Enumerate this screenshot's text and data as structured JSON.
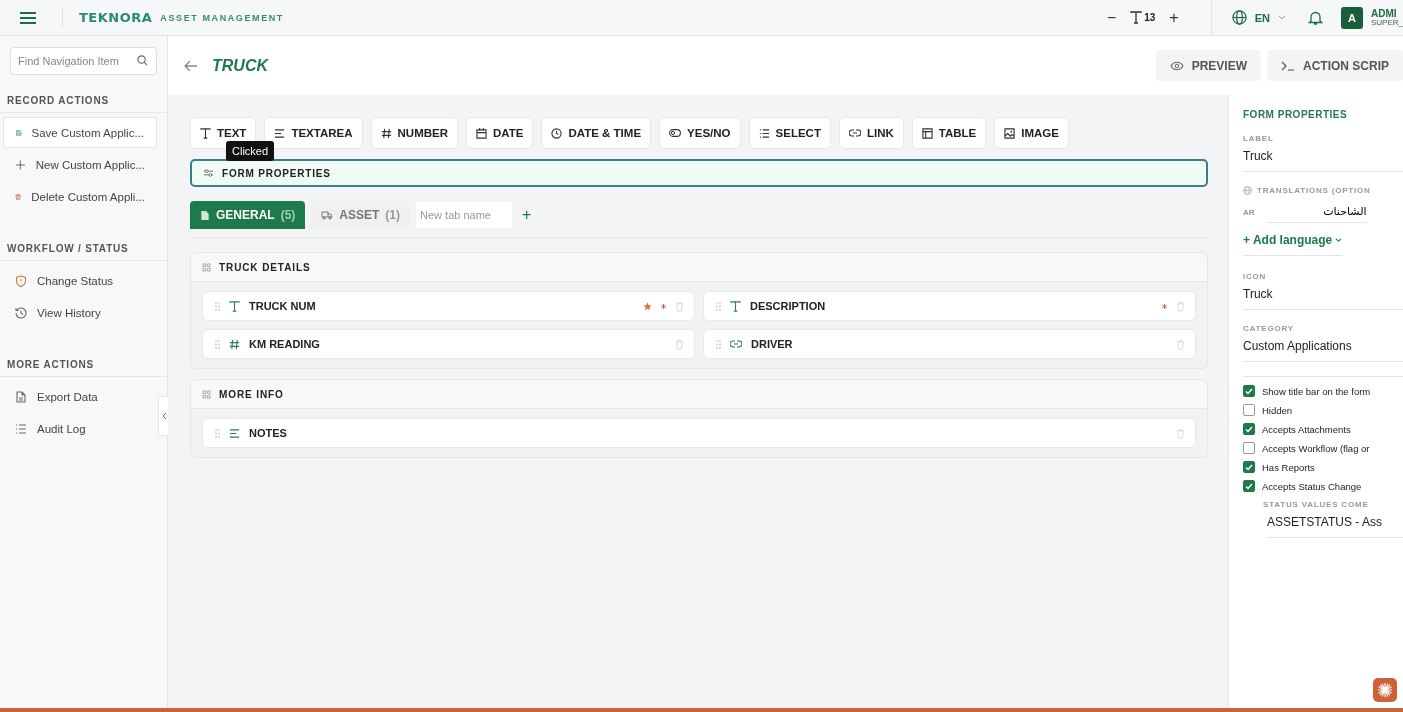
{
  "topbar": {
    "brand": "TEKNORA",
    "product": "ASSET MANAGEMENT",
    "font_decrease": "−",
    "font_size": "13",
    "font_increase": "+",
    "language": "EN",
    "avatar": "A",
    "user_name": "ADMI",
    "user_role": "SUPER_"
  },
  "sidebar": {
    "search": {
      "placeholder": "Find Navigation Item"
    },
    "sections": [
      {
        "title": "RECORD ACTIONS",
        "items": [
          {
            "label": "Save Custom Applic...",
            "selected": true
          },
          {
            "label": "New Custom Applic...",
            "selected": false
          },
          {
            "label": "Delete Custom Appli...",
            "selected": false
          }
        ]
      },
      {
        "title": "WORKFLOW / STATUS",
        "items": [
          {
            "label": "Change Status",
            "selected": false
          },
          {
            "label": "View History",
            "selected": false
          }
        ]
      },
      {
        "title": "MORE ACTIONS",
        "items": [
          {
            "label": "Export Data",
            "selected": false
          },
          {
            "label": "Audit Log",
            "selected": false
          }
        ]
      }
    ]
  },
  "header": {
    "title": "TRUCK",
    "buttons": [
      "PREVIEW",
      "ACTION SCRIP"
    ]
  },
  "field_types": [
    {
      "label": "TEXT",
      "kind": "text"
    },
    {
      "label": "TEXTAREA",
      "kind": "textarea"
    },
    {
      "label": "NUMBER",
      "kind": "number"
    },
    {
      "label": "DATE",
      "kind": "date"
    },
    {
      "label": "DATE & TIME",
      "kind": "datetime"
    },
    {
      "label": "YES/NO",
      "kind": "boolean"
    },
    {
      "label": "SELECT",
      "kind": "select"
    },
    {
      "label": "LINK",
      "kind": "link"
    },
    {
      "label": "TABLE",
      "kind": "table"
    },
    {
      "label": "IMAGE",
      "kind": "image"
    }
  ],
  "tooltip": "Clicked",
  "form_properties_bar": {
    "label": "FORM PROPERTIES",
    "selected": true
  },
  "tabs": [
    {
      "label": "GENERAL",
      "count": "(5)",
      "selected": true
    },
    {
      "label": "ASSET",
      "count": "(1)",
      "selected": false
    }
  ],
  "new_tab": {
    "placeholder": "New tab name",
    "add": "+"
  },
  "sections": [
    {
      "title": "TRUCK DETAILS",
      "fields": [
        {
          "label": "TRUCK NUM",
          "kind": "text",
          "starred": true,
          "required": true
        },
        {
          "label": "DESCRIPTION",
          "kind": "text",
          "starred": false,
          "required": true
        },
        {
          "label": "KM READING",
          "kind": "number",
          "starred": false,
          "required": false
        },
        {
          "label": "DRIVER",
          "kind": "link",
          "starred": false,
          "required": false
        }
      ]
    },
    {
      "title": "MORE INFO",
      "fields": [
        {
          "label": "NOTES",
          "kind": "textarea",
          "starred": false,
          "required": false
        }
      ]
    }
  ],
  "properties": {
    "title": "FORM PROPERTIES",
    "label_heading": "LABEL",
    "label_value": "Truck",
    "translations_heading": "TRANSLATIONS (OPTION",
    "translations": [
      {
        "lang": "AR",
        "value": "الشاحنات"
      }
    ],
    "add_language": "+ Add language",
    "icon_heading": "ICON",
    "icon_value": "Truck",
    "category_heading": "CATEGORY",
    "category_value": "Custom Applications",
    "options": [
      {
        "label": "Show title bar on the form",
        "checked": true
      },
      {
        "label": "Hidden",
        "checked": false
      },
      {
        "label": "Accepts Attachments",
        "checked": true
      },
      {
        "label": "Accepts Workflow (flag or",
        "checked": false
      },
      {
        "label": "Has Reports",
        "checked": true
      },
      {
        "label": "Accepts Status Change",
        "checked": true
      }
    ],
    "status_heading": "STATUS VALUES COME",
    "status_value": "ASSETSTATUS - Ass"
  }
}
